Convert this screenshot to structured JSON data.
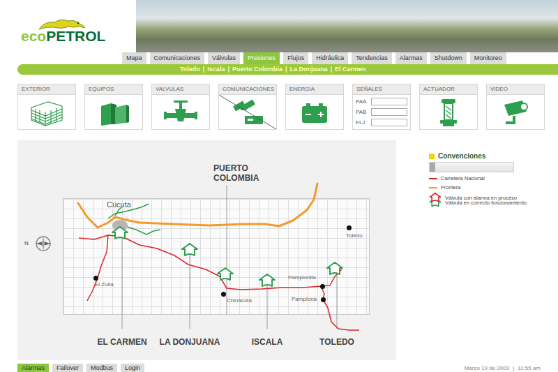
{
  "logo": {
    "prefix": "eco",
    "name": "PETROL"
  },
  "nav_tabs": [
    {
      "label": "Mapa",
      "selected": false
    },
    {
      "label": "Comunicaciones",
      "selected": false
    },
    {
      "label": "Válvulas",
      "selected": false
    },
    {
      "label": "Presiones",
      "selected": true
    },
    {
      "label": "Flujos",
      "selected": false
    },
    {
      "label": "Hidráulica",
      "selected": false
    },
    {
      "label": "Tendencias",
      "selected": false
    },
    {
      "label": "Alarmas",
      "selected": false
    },
    {
      "label": "Shutdown",
      "selected": false
    },
    {
      "label": "Monitoreo",
      "selected": false
    }
  ],
  "sub_nav": {
    "separator": "|",
    "items": [
      {
        "label": "Toledo"
      },
      {
        "label": "Iscala"
      },
      {
        "label": "Puerto Colombia"
      },
      {
        "label": "La Donjuana"
      },
      {
        "label": "El Carmen"
      }
    ]
  },
  "cards": [
    {
      "label": "EXTERIOR",
      "kind": "icon",
      "crossed": false
    },
    {
      "label": "EQUIPOS",
      "kind": "icon",
      "crossed": false
    },
    {
      "label": "VALVULAS",
      "kind": "icon",
      "crossed": false
    },
    {
      "label": "COMUNICACIONES",
      "kind": "icon",
      "crossed": true
    },
    {
      "label": "ENERGIA",
      "kind": "icon",
      "crossed": false
    },
    {
      "label": "SEÑALES",
      "kind": "fields",
      "crossed": false,
      "fields": [
        {
          "label": "PAA",
          "value": ""
        },
        {
          "label": "PAB",
          "value": ""
        },
        {
          "label": "FLJ",
          "value": ""
        }
      ]
    },
    {
      "label": "ACTUADOR",
      "kind": "icon",
      "crossed": false
    },
    {
      "label": "VIDEO",
      "kind": "icon",
      "crossed": false
    }
  ],
  "map": {
    "compass": "N",
    "top_station": "PUERTO COLOMBIA",
    "stations": [
      {
        "name": "EL CARMEN"
      },
      {
        "name": "LA DONJUANA"
      },
      {
        "name": "ISCALA"
      },
      {
        "name": "TOLEDO"
      }
    ],
    "cities": [
      {
        "name": "Cúcuta",
        "kind": "capital"
      },
      {
        "name": "El Zulia",
        "kind": "town"
      },
      {
        "name": "Chinácota",
        "kind": "town"
      },
      {
        "name": "Pamplonita",
        "kind": "town"
      },
      {
        "name": "Pamplona",
        "kind": "town"
      },
      {
        "name": "Toledo",
        "kind": "town"
      }
    ],
    "valves": [
      {
        "alarm": false
      },
      {
        "alarm": false
      },
      {
        "alarm": false
      },
      {
        "alarm": false
      },
      {
        "alarm": false
      }
    ]
  },
  "legend": {
    "title": "Convenciones",
    "level": 0.07,
    "items": [
      {
        "label": "Carretera Nacional",
        "kind": "line",
        "color": "#d9262c"
      },
      {
        "label": "Frontera",
        "kind": "line",
        "color": "#f39a2b"
      },
      {
        "label": "Válvula en correcto funcionamiento",
        "kind": "valve",
        "color": "#2e9e4f"
      },
      {
        "label": "Válvula con alarma en proceso",
        "kind": "valve",
        "color": "#d9262c"
      }
    ]
  },
  "footer": {
    "buttons": [
      {
        "label": "Alarmas",
        "selected": true
      },
      {
        "label": "Failover",
        "selected": false
      },
      {
        "label": "Modbus",
        "selected": false
      },
      {
        "label": "Login",
        "selected": false
      }
    ],
    "date": "Marzo 19 de 2009",
    "separator": "|",
    "time": "11:55 am"
  }
}
